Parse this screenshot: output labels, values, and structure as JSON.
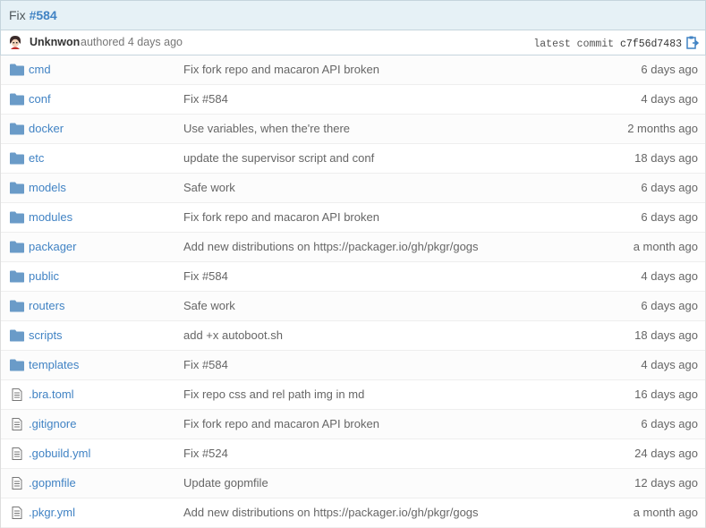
{
  "commit": {
    "title_prefix": "Fix ",
    "issue_ref": "#584",
    "author": "Unknwon",
    "authored_text": "authored 4 days ago",
    "latest_label": "latest commit",
    "sha": "c7f56d7483"
  },
  "colors": {
    "link": "#4183c4",
    "folder": "#5a8fbf",
    "header_bg": "#e6f1f6"
  },
  "files": [
    {
      "name": "cmd",
      "type": "folder",
      "message": "Fix fork repo and macaron API broken",
      "age": "6 days ago"
    },
    {
      "name": "conf",
      "type": "folder",
      "message": "Fix #584",
      "age": "4 days ago"
    },
    {
      "name": "docker",
      "type": "folder",
      "message": "Use variables, when the're there",
      "age": "2 months ago"
    },
    {
      "name": "etc",
      "type": "folder",
      "message": "update the supervisor script and conf",
      "age": "18 days ago"
    },
    {
      "name": "models",
      "type": "folder",
      "message": "Safe work",
      "age": "6 days ago"
    },
    {
      "name": "modules",
      "type": "folder",
      "message": "Fix fork repo and macaron API broken",
      "age": "6 days ago"
    },
    {
      "name": "packager",
      "type": "folder",
      "message": "Add new distributions on https://packager.io/gh/pkgr/gogs",
      "age": "a month ago"
    },
    {
      "name": "public",
      "type": "folder",
      "message": "Fix #584",
      "age": "4 days ago"
    },
    {
      "name": "routers",
      "type": "folder",
      "message": "Safe work",
      "age": "6 days ago"
    },
    {
      "name": "scripts",
      "type": "folder",
      "message": "add +x autoboot.sh",
      "age": "18 days ago"
    },
    {
      "name": "templates",
      "type": "folder",
      "message": "Fix #584",
      "age": "4 days ago"
    },
    {
      "name": ".bra.toml",
      "type": "file",
      "message": "Fix repo css and rel path img in md",
      "age": "16 days ago"
    },
    {
      "name": ".gitignore",
      "type": "file",
      "message": "Fix fork repo and macaron API broken",
      "age": "6 days ago"
    },
    {
      "name": ".gobuild.yml",
      "type": "file",
      "message": "Fix #524",
      "age": "24 days ago"
    },
    {
      "name": ".gopmfile",
      "type": "file",
      "message": "Update gopmfile",
      "age": "12 days ago"
    },
    {
      "name": ".pkgr.yml",
      "type": "file",
      "message": "Add new distributions on https://packager.io/gh/pkgr/gogs",
      "age": "a month ago"
    }
  ]
}
